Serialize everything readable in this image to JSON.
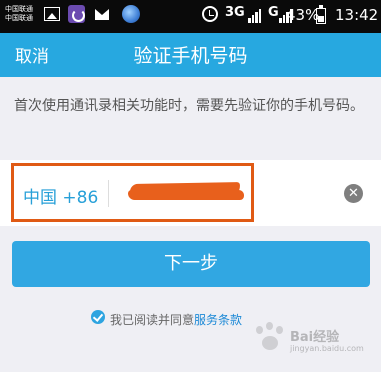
{
  "status_bar": {
    "carrier_top": "中国联通",
    "carrier_bottom": "中国联通",
    "network1": "3G",
    "network2": "G",
    "battery": "43%",
    "time": "13:42"
  },
  "nav": {
    "cancel_label": "取消",
    "title": "验证手机号码"
  },
  "description": "首次使用通讯录相关功能时，需要先验证你的手机号码。",
  "phone": {
    "country": "中国 +86",
    "value": ""
  },
  "next_button": "下一步",
  "agreement": {
    "text": "我已阅读并同意",
    "link": "服务条款"
  },
  "watermark": {
    "text": "Bai经验",
    "sub": "jingyan.baidu.com"
  },
  "colors": {
    "nav_bg": "#27a8e0",
    "button_bg": "#31a7e2",
    "highlight_frame": "#e05a14"
  }
}
